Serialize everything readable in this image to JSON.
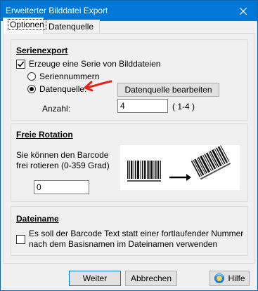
{
  "window": {
    "title": "Erweiterter Bilddatei Export",
    "close_icon": "close-icon"
  },
  "tabs": [
    {
      "label": "Optionen"
    },
    {
      "label": "Datenquelle"
    }
  ],
  "serienexport": {
    "title": "Serienexport",
    "checkbox_label": "Erzeuge eine Serie von Bilddateien",
    "checked": true,
    "radio_seriennummern": "Seriennummern",
    "radio_datenquelle": "Datenquelle:",
    "selected": "Datenquelle:",
    "datenquelle_button": "Datenquelle bearbeiten",
    "anzahl_label": "Anzahl:",
    "anzahl_value": "4",
    "anzahl_range": "( 1-4 )",
    "annotation_color": "#e8201c"
  },
  "rotation": {
    "title": "Freie Rotation",
    "description": "Sie können den Barcode frei rotieren (0-359 Grad)",
    "value": "0"
  },
  "dateiname": {
    "title": "Dateiname",
    "checkbox_label": "Es soll der Barcode Text statt einer fortlaufender Nummer nach dem Basisnamen im Dateinamen verwenden",
    "checked": false
  },
  "footer": {
    "weiter": "Weiter",
    "abbrechen": "Abbrechen",
    "hilfe": "Hilfe"
  }
}
